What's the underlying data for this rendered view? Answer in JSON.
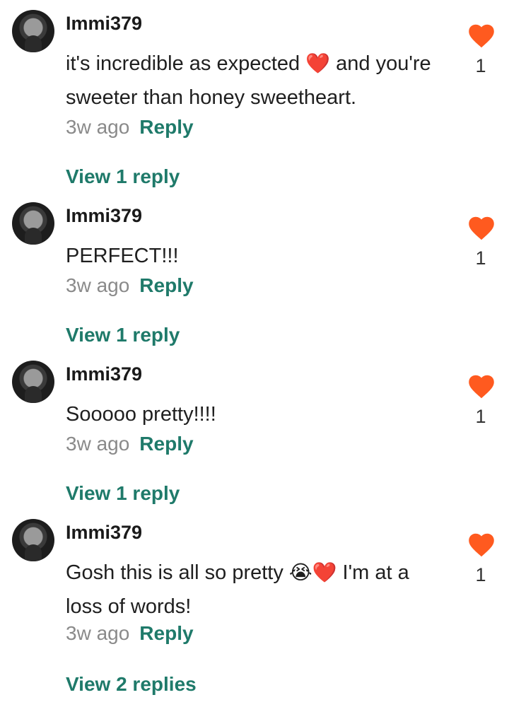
{
  "colors": {
    "accent": "#1f7a6a",
    "heart": "#ff5a1f",
    "muted": "#8a8a8a"
  },
  "comments": [
    {
      "username": "Immi379",
      "text_parts": [
        "it's incredible as expected ",
        "❤️",
        " and you're sweeter than honey sweetheart."
      ],
      "time": "3w ago",
      "reply_label": "Reply",
      "likes": "1",
      "view_replies": "View 1 reply"
    },
    {
      "username": "Immi379",
      "text_parts": [
        "PERFECT!!!",
        "",
        ""
      ],
      "time": "3w ago",
      "reply_label": "Reply",
      "likes": "1",
      "view_replies": "View 1 reply"
    },
    {
      "username": "Immi379",
      "text_parts": [
        "Sooooo pretty!!!!",
        "",
        ""
      ],
      "time": "3w ago",
      "reply_label": "Reply",
      "likes": "1",
      "view_replies": "View 1 reply"
    },
    {
      "username": "Immi379",
      "text_parts": [
        "Gosh this is all so pretty ",
        "😭❤️",
        " I'm at a loss of words!"
      ],
      "time": "3w ago",
      "reply_label": "Reply",
      "likes": "1",
      "view_replies": "View 2 replies"
    }
  ]
}
